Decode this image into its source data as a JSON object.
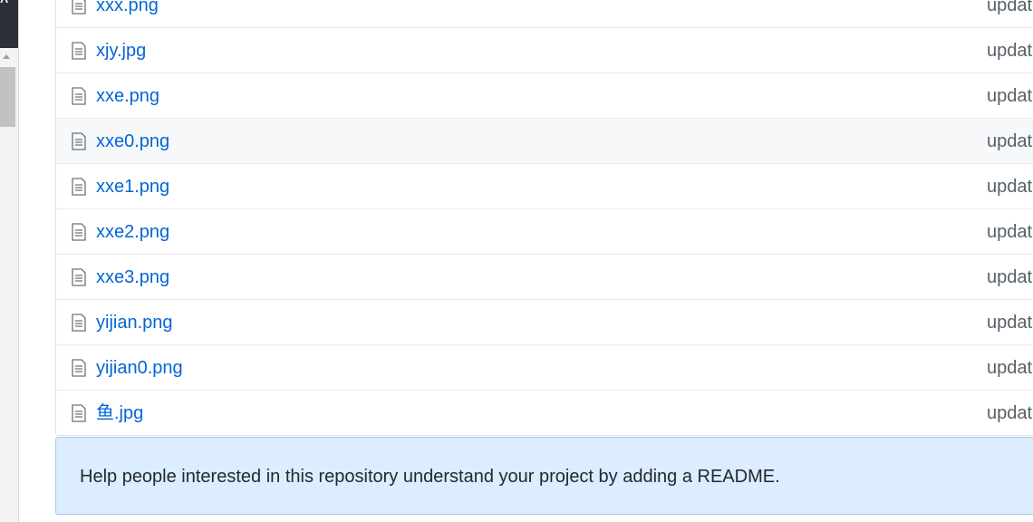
{
  "files": [
    {
      "name": "xxx.png",
      "commit": "update"
    },
    {
      "name": "xjy.jpg",
      "commit": "update"
    },
    {
      "name": "xxe.png",
      "commit": "update"
    },
    {
      "name": "xxe0.png",
      "commit": "update"
    },
    {
      "name": "xxe1.png",
      "commit": "update"
    },
    {
      "name": "xxe2.png",
      "commit": "update"
    },
    {
      "name": "xxe3.png",
      "commit": "update"
    },
    {
      "name": "yijian.png",
      "commit": "update"
    },
    {
      "name": "yijian0.png",
      "commit": "update"
    },
    {
      "name": "鱼.jpg",
      "commit": "update"
    }
  ],
  "readme_prompt": "Help people interested in this repository understand your project by adding a README.",
  "icons": {
    "file": "file-icon"
  },
  "colors": {
    "link": "#0366d6",
    "muted": "#586069",
    "readme_bg": "#dbedff"
  }
}
